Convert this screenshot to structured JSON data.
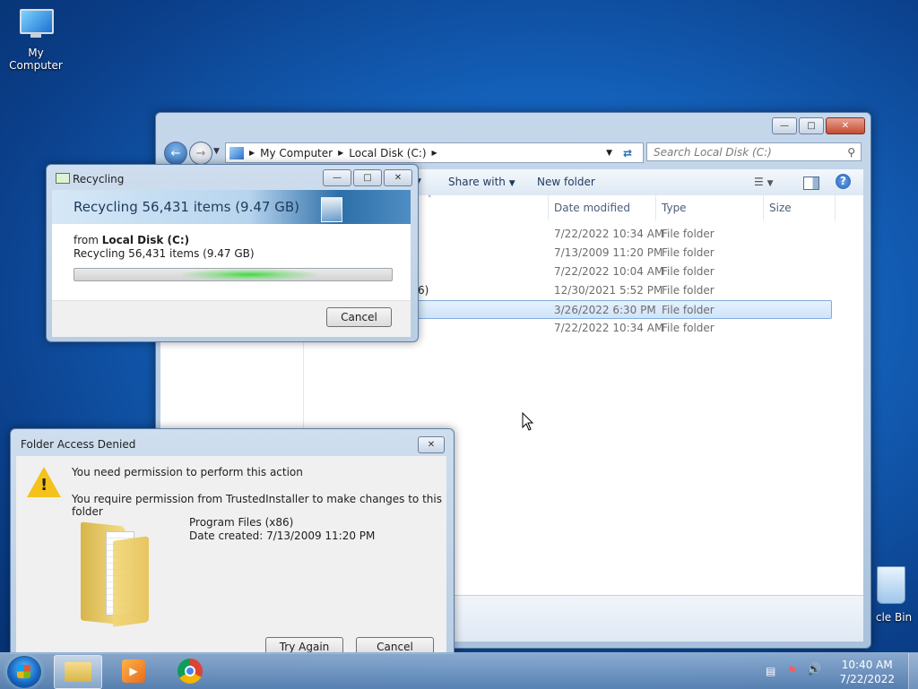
{
  "desktop": {
    "icons": [
      {
        "label": "My Computer"
      },
      {
        "label": "cle Bin"
      }
    ]
  },
  "explorer": {
    "breadcrumb": [
      "My Computer",
      "Local Disk (C:)"
    ],
    "search_placeholder": "Search Local Disk (C:)",
    "toolbar": {
      "share_with": "Share with",
      "new_folder": "New folder"
    },
    "columns": {
      "date_modified": "Date modified",
      "type": "Type",
      "size": "Size"
    },
    "rows": [
      {
        "name": "",
        "date": "7/22/2022 10:34 AM",
        "type": "File folder",
        "selected": false
      },
      {
        "name": "",
        "date": "7/13/2009 11:20 PM",
        "type": "File folder",
        "selected": false
      },
      {
        "name": "",
        "date": "7/22/2022 10:04 AM",
        "type": "File folder",
        "selected": false
      },
      {
        "name": "6)",
        "date": "12/30/2021 5:52 PM",
        "type": "File folder",
        "selected": false
      },
      {
        "name": "",
        "date": "3/26/2022 6:30 PM",
        "type": "File folder",
        "selected": true
      },
      {
        "name": "",
        "date": "7/22/2022 10:34 AM",
        "type": "File folder",
        "selected": false
      }
    ]
  },
  "recycling": {
    "title": "Recycling",
    "banner": "Recycling 56,431 items (9.47 GB)",
    "from_prefix": "from",
    "from_location": "Local Disk (C:)",
    "detail": "Recycling 56,431 items (9.47 GB)",
    "cancel_label": "Cancel"
  },
  "access_denied": {
    "title": "Folder Access Denied",
    "message1": "You need permission to perform this action",
    "message2": "You require permission from TrustedInstaller to make changes to this folder",
    "folder_name": "Program Files (x86)",
    "date_created": "Date created: 7/13/2009 11:20 PM",
    "try_again_label": "Try Again",
    "cancel_label": "Cancel"
  },
  "taskbar": {
    "time": "10:40 AM",
    "date": "7/22/2022"
  },
  "colors": {
    "accent": "#1565c0",
    "selection": "#cfe4fa",
    "warning": "#f4c21b"
  }
}
